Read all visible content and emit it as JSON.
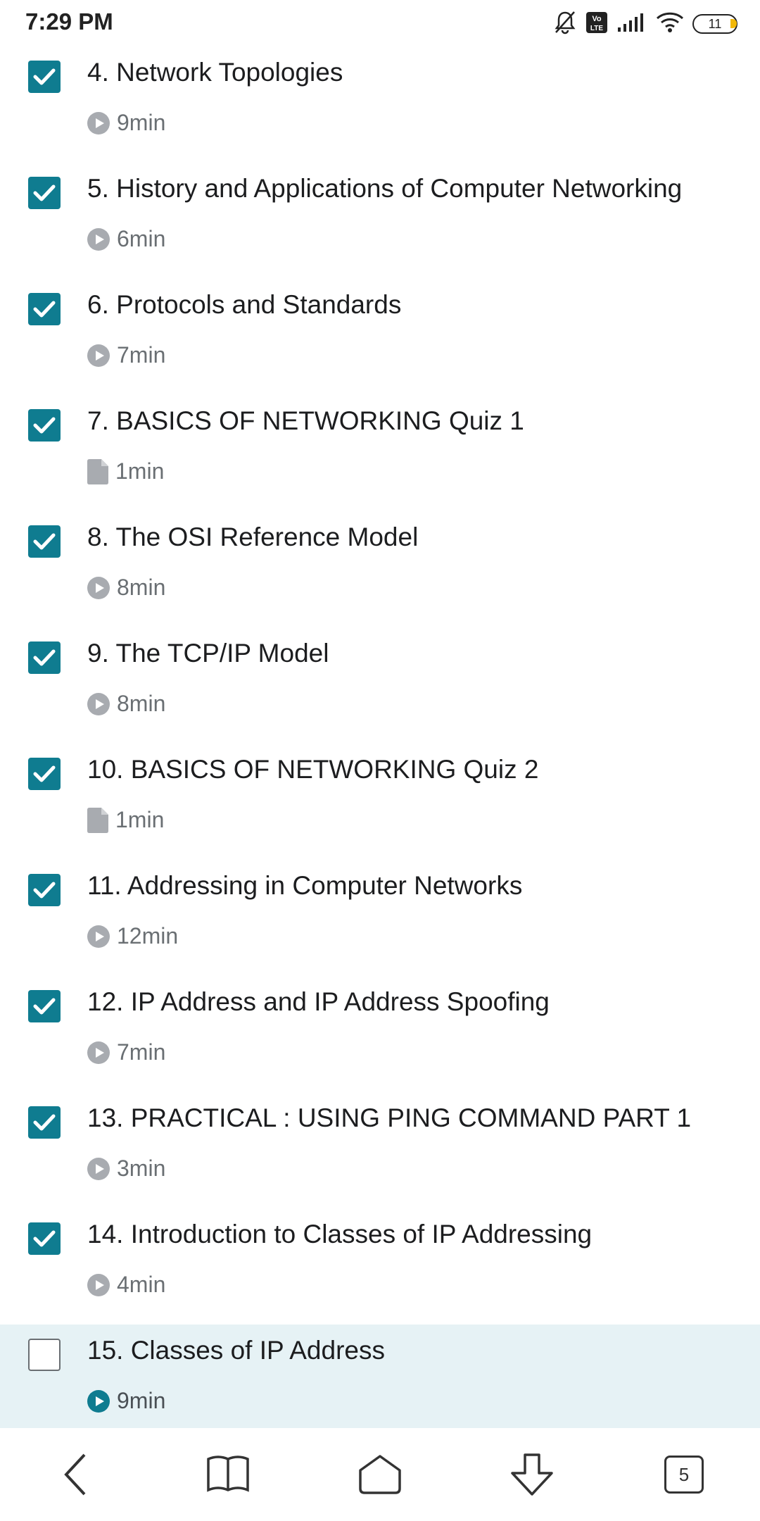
{
  "status_bar": {
    "time": "7:29 PM",
    "battery": "11",
    "icons": [
      "bell-muted-icon",
      "volte-icon",
      "signal-icon",
      "wifi-icon",
      "battery-icon"
    ]
  },
  "colors": {
    "checked": "#0f7c90",
    "current_row_bg": "#e6f2f5",
    "meta_gray": "#6a6f73"
  },
  "lectures": [
    {
      "title": "4. Network Topologies",
      "duration": "9min",
      "type": "video",
      "completed": true
    },
    {
      "title": "5. History and Applications of Computer Networking",
      "duration": "6min",
      "type": "video",
      "completed": true
    },
    {
      "title": "6. Protocols and Standards",
      "duration": "7min",
      "type": "video",
      "completed": true
    },
    {
      "title": "7. BASICS OF NETWORKING Quiz 1",
      "duration": "1min",
      "type": "document",
      "completed": true
    },
    {
      "title": "8. The OSI Reference Model",
      "duration": "8min",
      "type": "video",
      "completed": true
    },
    {
      "title": "9. The TCP/IP Model",
      "duration": "8min",
      "type": "video",
      "completed": true
    },
    {
      "title": "10. BASICS OF NETWORKING Quiz 2",
      "duration": "1min",
      "type": "document",
      "completed": true
    },
    {
      "title": "11. Addressing in Computer Networks",
      "duration": "12min",
      "type": "video",
      "completed": true
    },
    {
      "title": "12. IP Address and IP Address Spoofing",
      "duration": "7min",
      "type": "video",
      "completed": true
    },
    {
      "title": "13. PRACTICAL : USING PING COMMAND PART 1",
      "duration": "3min",
      "type": "video",
      "completed": true
    },
    {
      "title": "14. Introduction to Classes of IP Addressing",
      "duration": "4min",
      "type": "video",
      "completed": true
    },
    {
      "title": "15. Classes of IP Address",
      "duration": "9min",
      "type": "video",
      "completed": false,
      "current": true
    }
  ],
  "nav": {
    "items": [
      "back-icon",
      "book-icon",
      "home-icon",
      "download-icon",
      "tabs-icon"
    ],
    "tabs_count": "5"
  }
}
